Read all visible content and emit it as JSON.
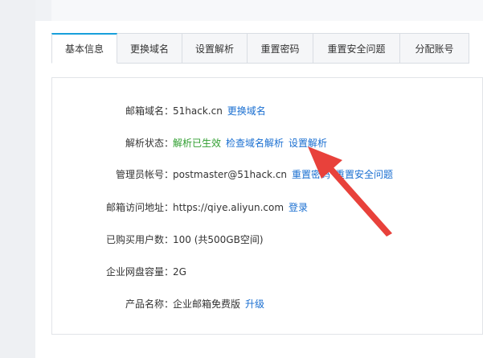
{
  "tabs": [
    {
      "label": "基本信息",
      "active": true
    },
    {
      "label": "更换域名"
    },
    {
      "label": "设置解析"
    },
    {
      "label": "重置密码"
    },
    {
      "label": "重置安全问题"
    },
    {
      "label": "分配账号"
    }
  ],
  "info": {
    "domain": {
      "label": "邮箱域名：",
      "value": "51hack.cn",
      "action": "更换域名"
    },
    "dns": {
      "label": "解析状态：",
      "status": "解析已生效",
      "check": "检查域名解析",
      "setup": "设置解析"
    },
    "admin": {
      "label": "管理员帐号：",
      "value": "postmaster@51hack.cn",
      "reset_password": "重置密码",
      "reset_question": "重置安全问题"
    },
    "url": {
      "label": "邮箱访问地址：",
      "value": "https://qiye.aliyun.com",
      "login": "登录"
    },
    "users": {
      "label": "已购买用户数：",
      "value": "100  (共500GB空间)"
    },
    "disk": {
      "label": "企业网盘容量：",
      "value": "2G"
    },
    "product": {
      "label": "产品名称：",
      "value": "企业邮箱免费版",
      "upgrade": "升级"
    }
  },
  "colors": {
    "accent": "#18a0db",
    "link": "#1a6fd1",
    "success": "#2f9e2f",
    "annotation": "#e8413b"
  }
}
